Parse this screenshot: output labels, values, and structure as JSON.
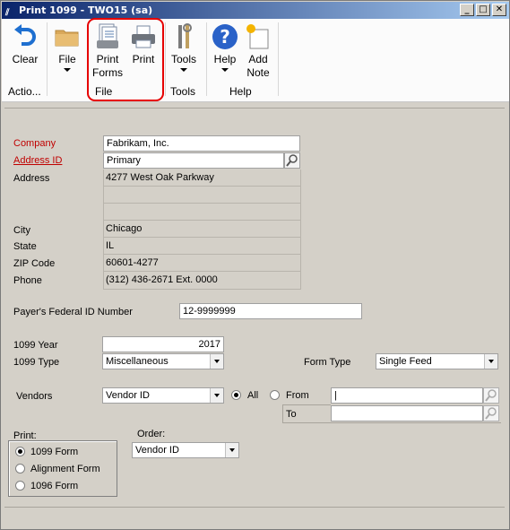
{
  "window": {
    "title": "Print 1099  -  TWO15 (sa)",
    "controls": {
      "minimize": "_",
      "maximize": "□",
      "close": "✕"
    }
  },
  "ribbon": {
    "buttons": {
      "clear": "Clear",
      "file": "File",
      "print_forms_line1": "Print",
      "print_forms_line2": "Forms",
      "print": "Print",
      "tools": "Tools",
      "help": "Help",
      "add_note_line1": "Add",
      "add_note_line2": "Note"
    },
    "groups": {
      "actions": "Actio...",
      "file": "File",
      "tools": "Tools",
      "help": "Help"
    }
  },
  "form": {
    "company_label": "Company",
    "company_value": "Fabrikam, Inc.",
    "address_id_label": "Address ID",
    "address_id_value": "Primary",
    "address_label": "Address",
    "address_line1": "4277 West Oak Parkway",
    "address_line2": "",
    "address_line3": "",
    "city_label": "City",
    "city_value": "Chicago",
    "state_label": "State",
    "state_value": "IL",
    "zip_label": "ZIP Code",
    "zip_value": "60601-4277",
    "phone_label": "Phone",
    "phone_value": "(312) 436-2671  Ext. 0000",
    "federal_id_label": "Payer's Federal ID Number",
    "federal_id_value": "12-9999999",
    "year_label": "1099 Year",
    "year_value": "2017",
    "type_label": "1099 Type",
    "type_value": "Miscellaneous",
    "form_type_label": "Form Type",
    "form_type_value": "Single Feed",
    "vendors_label": "Vendors",
    "vendors_value": "Vendor ID",
    "all_label": "All",
    "from_label": "From",
    "from_value": "|",
    "to_label": "To",
    "to_value": ""
  },
  "print_group": {
    "label": "Print:",
    "options": [
      "1099 Form",
      "Alignment Form",
      "1096 Form"
    ],
    "selected": "1099 Form"
  },
  "order": {
    "label": "Order:",
    "value": "Vendor ID"
  },
  "colors": {
    "highlight": "#e60000",
    "required_label": "#c00000",
    "title_bar": "#0a246a"
  }
}
